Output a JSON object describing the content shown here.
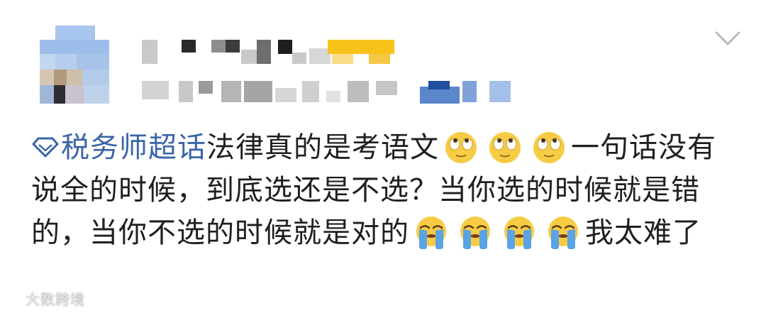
{
  "post": {
    "topic_label": "税务师超话",
    "text_segments": [
      "法律真的是考语文",
      "一句话没有说全的时候，到底选还是不选？当你选的时候就是错的，当你不选的时候就是对的",
      "我太难了"
    ],
    "emojis": {
      "eye_roll": "rolling-eyes-emoji",
      "crying": "crying-emoji"
    }
  },
  "watermark": {
    "text": "大数跨境"
  },
  "colors": {
    "topic_link": "#3a64a8",
    "text": "#1f1f1f",
    "chevron": "#b9b9b9"
  }
}
